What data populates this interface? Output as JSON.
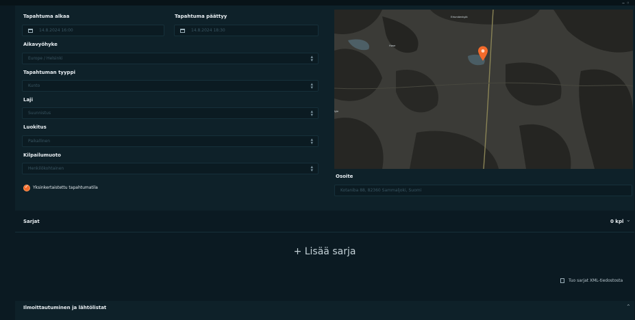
{
  "event": {
    "start_label": "Tapahtuma alkaa",
    "start_value": "14.8.2024 16:00",
    "end_label": "Tapahtuma päättyy",
    "end_value": "14.8.2024 18:30",
    "timezone_label": "Aikavyöhyke",
    "timezone_value": "Europe / Helsinki",
    "type_label": "Tapahtuman tyyppi",
    "type_value": "Kunto",
    "sport_label": "Laji",
    "sport_value": "Suunnistus",
    "class_label": "Luokitus",
    "class_value": "Paikallinen",
    "format_label": "Kilpailumuoto",
    "format_value": "Henkilökohtainen",
    "simplified_label": "Yksinkertaistettu tapahtumatila",
    "simplified_checked": true
  },
  "map": {
    "places": [
      "Ertumäenkylä",
      "Hase",
      "Iyle"
    ],
    "address_label": "Osoite",
    "address_value": "Kotaniba 88, 82360 Sammaljoki, Suomi",
    "corner_icon": "minimize-icon"
  },
  "series": {
    "label": "Sarjat",
    "count": "0 kpl",
    "add_label": "+ Lisää sarja",
    "import_label": "Tuo sarjat XML-tiedostosta"
  },
  "registration": {
    "label": "Ilmoittautuminen ja lähtölistat"
  },
  "colors": {
    "background": "#0b1a22",
    "panel": "#0e2129",
    "accent": "#f26a2b"
  }
}
